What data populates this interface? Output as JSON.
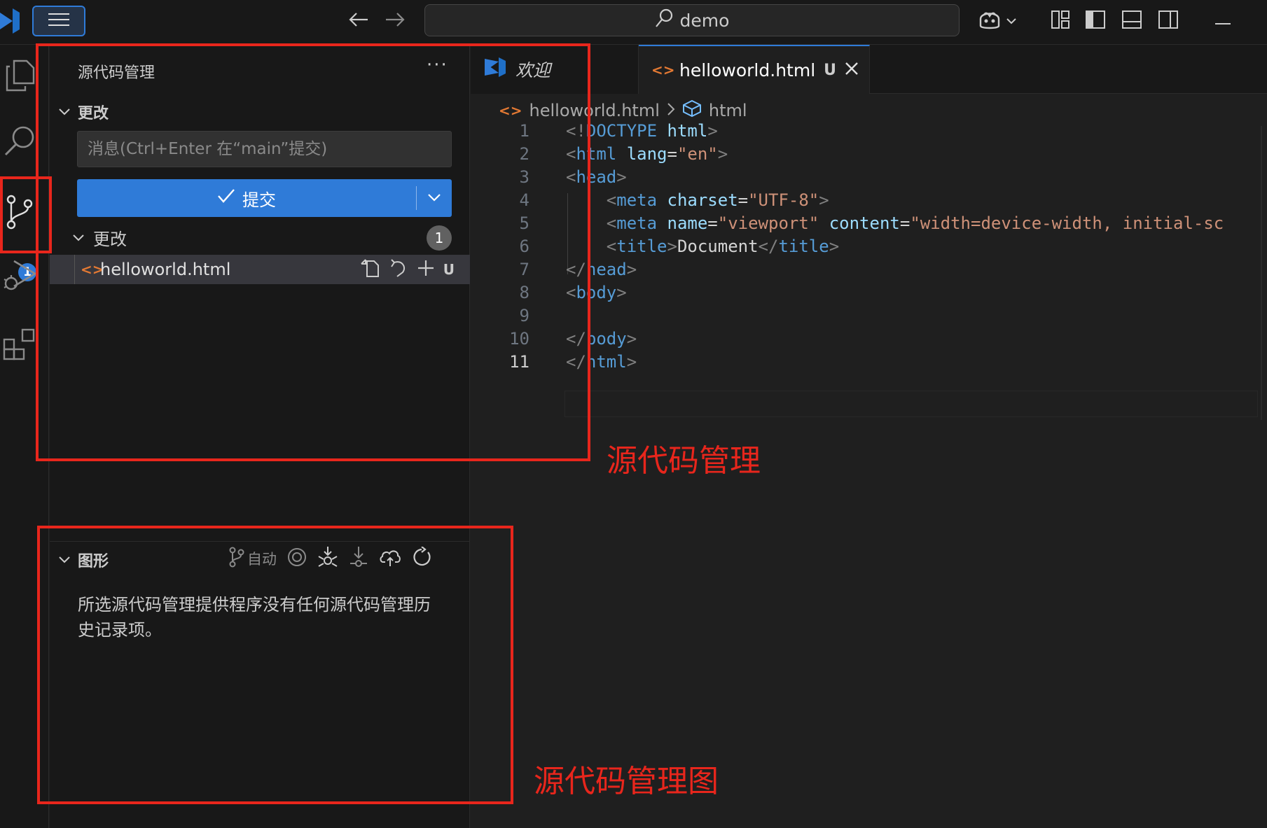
{
  "titlebar": {
    "search_text": "demo",
    "icons": [
      "vscode-logo-icon",
      "menu-icon",
      "back-arrow-icon",
      "forward-arrow-icon",
      "search-icon",
      "copilot-icon",
      "chevron-down-icon",
      "customize-layout-icon",
      "toggle-primary-sidebar-icon",
      "toggle-panel-icon",
      "toggle-secondary-sidebar-icon",
      "minimize-icon"
    ]
  },
  "activitybar": {
    "items": [
      "explorer-icon",
      "search-icon",
      "source-control-icon",
      "run-debug-icon",
      "extensions-icon"
    ],
    "scm_badge": "1"
  },
  "sidebar": {
    "title": "源代码管理",
    "more": "···",
    "changes_section_title": "更改",
    "commit_placeholder": "消息(Ctrl+Enter 在“main”提交)",
    "commit_label": "提交",
    "changes_group_label": "更改",
    "changes_count": "1",
    "file": {
      "name": "helloworld.html",
      "status": "U"
    },
    "graph": {
      "title": "图形",
      "branch_label": "自动",
      "message": "所选源代码管理提供程序没有任何源代码管理历史记录项。"
    }
  },
  "editor": {
    "tabs": [
      {
        "label": "欢迎",
        "active": false
      },
      {
        "label": "helloworld.html",
        "status": "U",
        "active": true
      }
    ],
    "breadcrumb": [
      "helloworld.html",
      "html"
    ],
    "line_numbers": [
      "1",
      "2",
      "3",
      "4",
      "5",
      "6",
      "7",
      "8",
      "9",
      "10",
      "11"
    ],
    "code_lines": [
      "<!DOCTYPE html>",
      "<html lang=\"en\">",
      "<head>",
      "    <meta charset=\"UTF-8\">",
      "    <meta name=\"viewport\" content=\"width=device-width, initial-sc",
      "    <title>Document</title>",
      "</head>",
      "<body>",
      "",
      "</body>",
      "</html>"
    ]
  },
  "annotations": {
    "scm_label": "源代码管理",
    "graph_label": "源代码管理图",
    "color": "#e8261c"
  },
  "colors": {
    "accent": "#2f7bd8",
    "html_icon": "#e37933",
    "background": "#1f1f1f",
    "sidebar": "#181818"
  }
}
